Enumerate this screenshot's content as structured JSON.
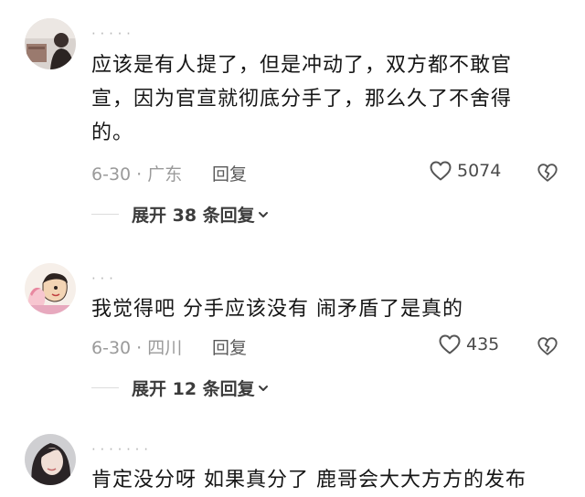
{
  "comments": [
    {
      "username": "· · · · ·",
      "text_lines": [
        "应该是有人提了，但是冲动了，双方都不敢官",
        "宣，因为官宣就彻底分手了，那么久了不舍得",
        "的。"
      ],
      "date_location": "6-30 · 广东",
      "reply_label": "回复",
      "like_count": "5074",
      "expand_label": "展开 38 条回复"
    },
    {
      "username": "· · ·",
      "text_lines": [
        "我觉得吧 分手应该没有 闹矛盾了是真的"
      ],
      "date_location": "6-30 · 四川",
      "reply_label": "回复",
      "like_count": "435",
      "expand_label": "展开 12 条回复"
    },
    {
      "username": "· · · · · · ·",
      "text_lines": [
        "肯定没分呀 如果真分了 鹿哥会大大方方的发布"
      ]
    }
  ],
  "icons": {
    "like": "heart-outline-icon",
    "dislike": "broken-heart-icon",
    "expand": "chevron-down-icon"
  },
  "colors": {
    "text_primary": "#161616",
    "text_meta": "#9a9a9a",
    "icon_gray": "#555555"
  }
}
